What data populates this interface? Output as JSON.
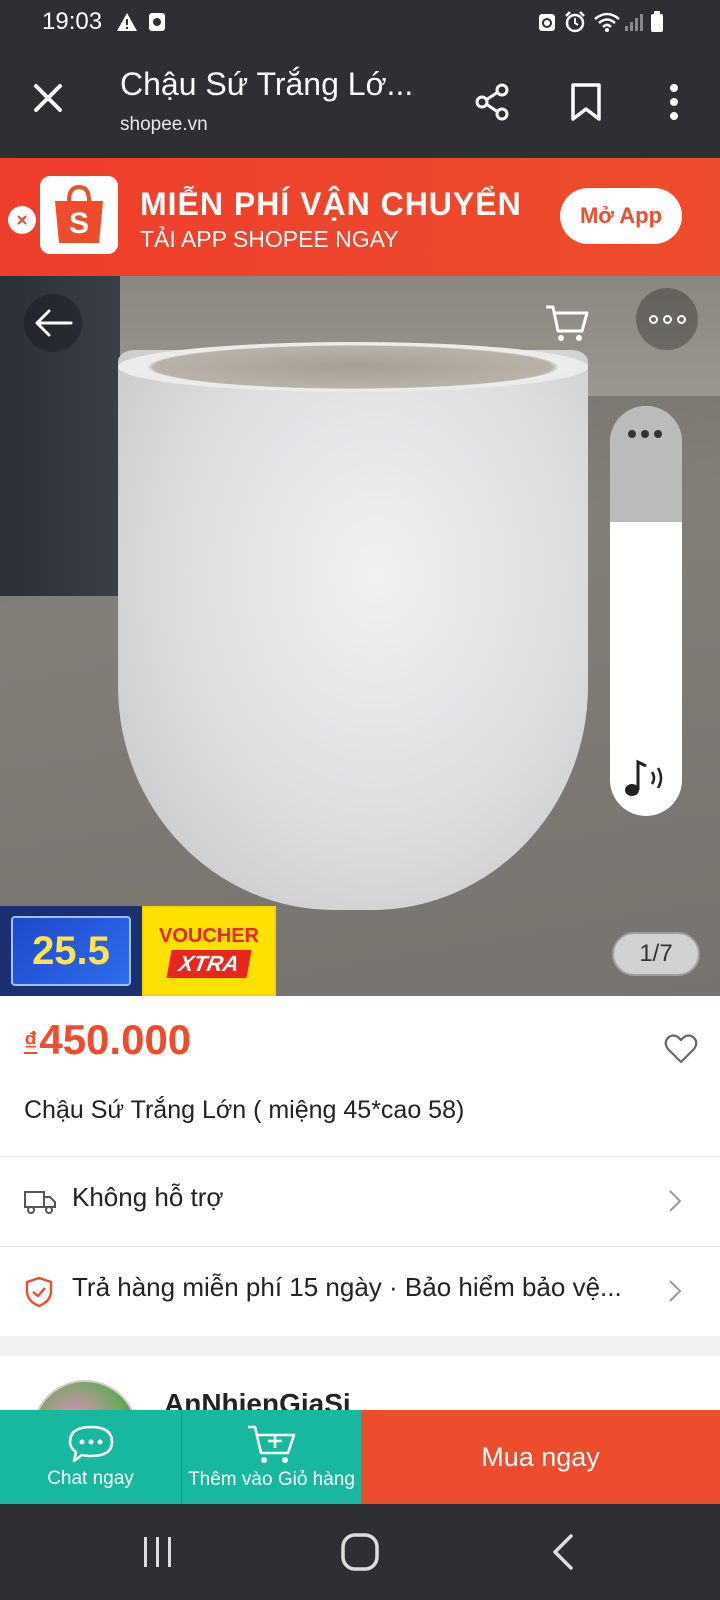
{
  "status_bar": {
    "time": "19:03",
    "icons": [
      "alert-icon",
      "media-icon",
      "recycle-icon",
      "alarm-icon",
      "wifi-icon",
      "signal-icon",
      "battery-icon"
    ]
  },
  "browser": {
    "title": "Chậu Sứ Trắng Lớ...",
    "domain": "shopee.vn",
    "icons": [
      "close-icon",
      "share-icon",
      "bookmark-icon",
      "more-vert-icon"
    ]
  },
  "promo": {
    "headline": "MIỄN PHÍ VẬN CHUYỂN",
    "subline": "TẢI APP SHOPEE NGAY",
    "open_app_label": "Mở App",
    "logo_letter": "S",
    "brand_color": "#ee4d2d"
  },
  "gallery": {
    "counter": "1/7",
    "badge_sale": "25.5",
    "badge_voucher_top": "VOUCHER",
    "badge_voucher_bottom": "XTRA",
    "icons": [
      "back-arrow-icon",
      "cart-icon",
      "more-horiz-icon",
      "music-note-icon"
    ]
  },
  "product": {
    "currency": "₫",
    "price": "450.000",
    "name": "Chậu Sứ Trắng Lớn ( miệng 45*cao 58)",
    "shipping": "Không hỗ trợ",
    "guarantee": "Trả hàng miễn phí 15 ngày · Bảo hiểm bảo vệ..."
  },
  "seller": {
    "name": "AnNhienGiaSi"
  },
  "actions": {
    "chat_label": "Chat ngay",
    "add_cart_label": "Thêm vào Giỏ hàng",
    "buy_label": "Mua ngay",
    "accent_teal": "#17b89f",
    "accent_orange": "#ee4d2d"
  },
  "navigation": {
    "icons": [
      "recent-apps-icon",
      "home-icon",
      "back-icon"
    ]
  }
}
